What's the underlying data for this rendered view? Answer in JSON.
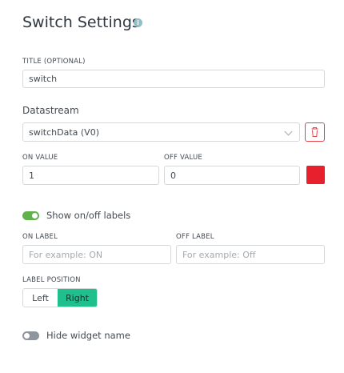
{
  "header": {
    "title": "Switch Settings",
    "info_icon": "info-icon"
  },
  "title_field": {
    "label": "TITLE (OPTIONAL)",
    "value": "switch"
  },
  "datastream": {
    "label": "Datastream",
    "value": "switchData (V0)",
    "chevron_icon": "chevron-down-icon",
    "delete_icon": "trash-icon"
  },
  "values": {
    "on_label": "ON VALUE",
    "on_value": "1",
    "off_label": "OFF VALUE",
    "off_value": "0",
    "color": "#e8202e"
  },
  "show_labels": {
    "label": "Show on/off labels",
    "enabled": true
  },
  "labels": {
    "on_label": "ON LABEL",
    "on_placeholder": "For example: ON",
    "off_label": "OFF LABEL",
    "off_placeholder": "For example: Off"
  },
  "label_position": {
    "label": "LABEL POSITION",
    "options": [
      "Left",
      "Right"
    ],
    "selected": "Right"
  },
  "hide_name": {
    "label": "Hide widget name",
    "enabled": false
  },
  "colors": {
    "accent_green": "#1fc08c",
    "toggle_on": "#5eb14b",
    "toggle_off": "#8e959c",
    "danger": "#e8434d"
  }
}
